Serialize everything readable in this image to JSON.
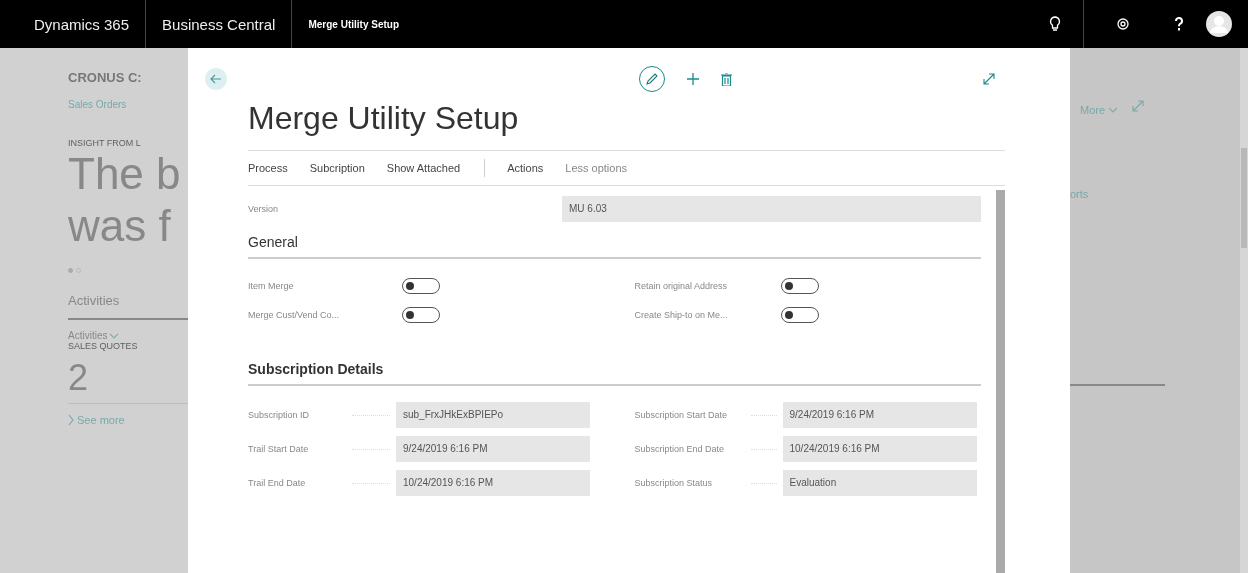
{
  "top_bar": {
    "product": "Dynamics 365",
    "app": "Business Central",
    "page": "Merge Utility Setup"
  },
  "background": {
    "company": "CRONUS C:",
    "link": "Sales Orders",
    "insight_label": "INSIGHT FROM L",
    "headline_lines": [
      "The b",
      "was f"
    ],
    "carousel_dots": [
      {
        "selected": true
      },
      {
        "selected": false
      }
    ],
    "section": "Activities",
    "activities_menu": "Activities",
    "cue_label": "SALES QUOTES",
    "cue_value": "2",
    "see_more": "See more",
    "more_menu": "More",
    "cut_link": "orts"
  },
  "dialog": {
    "title": "Merge Utility Setup",
    "action_groups": [
      [
        {
          "label": "Process",
          "kind": "menu"
        },
        {
          "label": "Subcription",
          "kind": "menu"
        },
        {
          "label": "Show Attached",
          "kind": "menu"
        }
      ],
      [
        {
          "label": "Actions",
          "kind": "menu"
        },
        {
          "label": "Less options",
          "kind": "option"
        }
      ]
    ],
    "version": {
      "label": "Version",
      "value": "MU 6.03"
    },
    "sections": [
      {
        "title": "General",
        "kind": "toggles",
        "columns": [
          [
            {
              "label": "Item Merge",
              "on": false
            },
            {
              "label": "Merge Cust/Vend Co...",
              "on": false
            }
          ],
          [
            {
              "label": "Retain original Address",
              "on": false
            },
            {
              "label": "Create Ship-to on Me...",
              "on": false
            }
          ]
        ]
      },
      {
        "title": "Subscription Details",
        "kind": "values",
        "columns": [
          [
            {
              "label": "Subscription ID",
              "value": "sub_FrxJHkExBPIEPo"
            },
            {
              "label": "Trail Start Date",
              "value": "9/24/2019 6:16 PM"
            },
            {
              "label": "Trail End Date",
              "value": "10/24/2019 6:16 PM"
            }
          ],
          [
            {
              "label": "Subscription Start Date",
              "value": "9/24/2019 6:16 PM"
            },
            {
              "label": "Subscription End Date",
              "value": "10/24/2019 6:16 PM"
            },
            {
              "label": "Subscription Status",
              "value": "Evaluation"
            }
          ]
        ]
      }
    ]
  }
}
